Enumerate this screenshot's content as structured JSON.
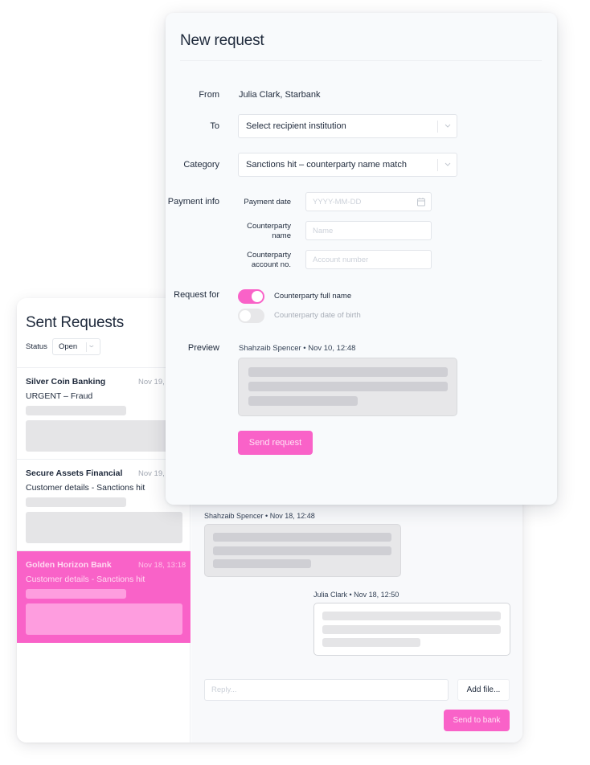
{
  "colors": {
    "accent": "#f962c8",
    "accent_light": "#fe9ddf",
    "text": "#1e293b",
    "muted": "#a3a9b3"
  },
  "sent_requests": {
    "title": "Sent Requests",
    "status_label": "Status",
    "status_value": "Open",
    "items": [
      {
        "name": "Silver Coin Banking",
        "date": "Nov 19,",
        "subject": "URGENT – Fraud",
        "active": false
      },
      {
        "name": "Secure Assets Financial",
        "date": "Nov 19, 1",
        "subject": "Customer details - Sanctions hit",
        "active": false
      },
      {
        "name": "Golden Horizon Bank",
        "date": "Nov 18, 13:18",
        "subject": "Customer details - Sanctions hit",
        "active": true
      }
    ]
  },
  "thread": {
    "messages": [
      {
        "meta": "Shahzaib Spencer • Nov 18, 12:48",
        "direction": "incoming"
      },
      {
        "meta": "Julia Clark • Nov 18, 12:50",
        "direction": "outgoing"
      }
    ],
    "reply_placeholder": "Reply...",
    "add_file_label": "Add file...",
    "send_label": "Send to bank"
  },
  "new_request": {
    "title": "New request",
    "from_label": "From",
    "from_value": "Julia Clark, Starbank",
    "to_label": "To",
    "to_value": "Select recipient institution",
    "category_label": "Category",
    "category_value": "Sanctions hit – counterparty name match",
    "payment_info_label": "Payment info",
    "payment_date_label": "Payment date",
    "payment_date_placeholder": "YYYY-MM-DD",
    "cp_name_label": "Counterparty name",
    "cp_name_placeholder": "Name",
    "cp_account_label": "Counterparty account no.",
    "cp_account_placeholder": "Account number",
    "request_for_label": "Request for",
    "toggles": [
      {
        "label": "Counterparty full name",
        "on": true
      },
      {
        "label": "Counterparty date of birth",
        "on": false
      }
    ],
    "preview_label": "Preview",
    "preview_meta": "Shahzaib Spencer • Nov 10, 12:48",
    "send_label": "Send request"
  }
}
